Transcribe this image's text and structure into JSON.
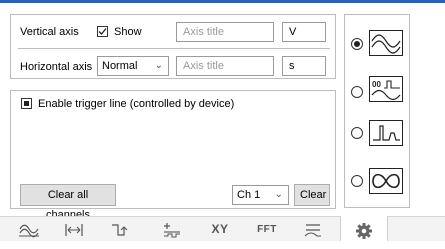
{
  "vertical_axis": {
    "label": "Vertical axis",
    "show_label": "Show",
    "show_checked": true,
    "title_placeholder": "Axis title",
    "unit_value": "V"
  },
  "horizontal_axis": {
    "label": "Horizontal axis",
    "scale_selected": "Normal",
    "title_placeholder": "Axis title",
    "unit_value": "s"
  },
  "trigger": {
    "label": "Enable trigger line (controlled by device)",
    "checked": true
  },
  "bottom": {
    "clear_all_label": "Clear all channels",
    "channel_selected": "Ch 1",
    "clear_label": "Clear"
  },
  "display_modes": [
    {
      "icon": "sine-wave-icon",
      "selected": true
    },
    {
      "icon": "pulse-sine-overlay-icon",
      "selected": false
    },
    {
      "icon": "pulse-icon",
      "selected": false
    },
    {
      "icon": "infinity-loop-icon",
      "selected": false
    }
  ],
  "display_mode_digits_label": "00",
  "toolbar": {
    "tabs": [
      {
        "name": "waveform-tab-icon"
      },
      {
        "name": "horizontal-measure-tab-icon"
      },
      {
        "name": "trigger-tab-icon"
      },
      {
        "name": "math-tab-icon"
      },
      {
        "name": "xy",
        "label": "XY"
      },
      {
        "name": "fft",
        "label": "FFT"
      },
      {
        "name": "filter-tab-icon"
      },
      {
        "name": "settings-gear-icon"
      }
    ]
  },
  "colors": {
    "accent": "#1e64c8",
    "border": "#bdbdbd",
    "button_bg": "#e1e1e1",
    "placeholder": "#9a9a9a",
    "active_tab_bg": "#ffffff",
    "toolbar_bg": "#f3f3f3"
  }
}
